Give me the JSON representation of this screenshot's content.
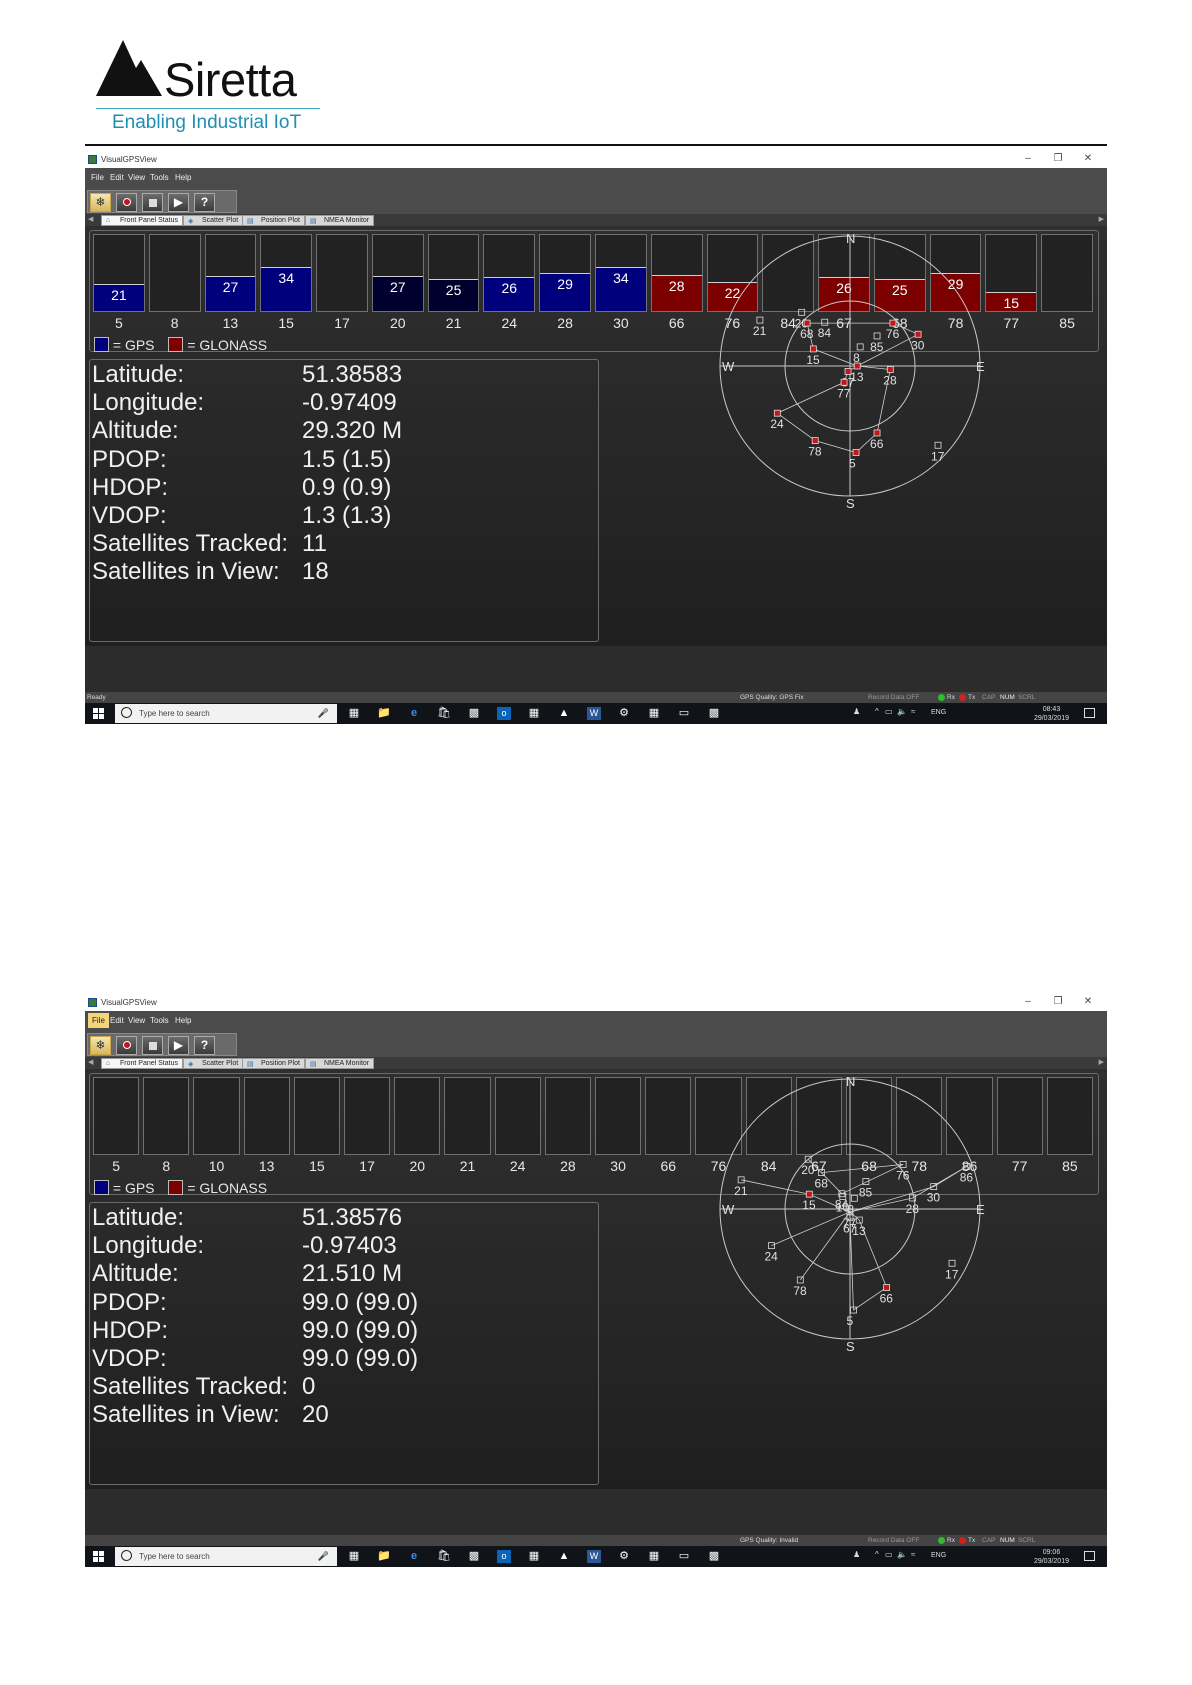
{
  "brand": {
    "name": "Siretta",
    "tagline": "Enabling Industrial IoT"
  },
  "colors": {
    "gps_bar": "#00007c",
    "gps_bar_weak": "#00002e",
    "glonass_bar": "#7c0000",
    "panel_bg": "#2c2c2c",
    "accent_menu": "#f6d47a"
  },
  "app": {
    "window_title": "VisualGPSView",
    "menu": [
      "File",
      "Edit",
      "View",
      "Tools",
      "Help"
    ],
    "toolbar_icons": [
      "gps-settings-icon",
      "record-icon",
      "stop-icon",
      "play-icon",
      "help-icon"
    ],
    "toolbar_help_glyph": "?",
    "tabs": [
      "Front Panel Status",
      "Scatter Plot",
      "Position Plot",
      "NMEA Monitor"
    ],
    "legend": {
      "gps": "= GPS",
      "glonass": "= GLONASS"
    },
    "info_labels": [
      "Latitude:",
      "Longitude:",
      "Altitude:",
      "PDOP:",
      "HDOP:",
      "VDOP:",
      "Satellites Tracked:",
      "Satellites in View:"
    ],
    "compass": {
      "n": "N",
      "s": "S",
      "e": "E",
      "w": "W"
    },
    "status_record": "Record Data OFF",
    "status_rx": "Rx",
    "status_tx": "Tx",
    "status_keys": [
      "CAP",
      "NUM",
      "SCRL"
    ],
    "task_search_placeholder": "Type here to search",
    "tray_lang": "ENG"
  },
  "screens": [
    {
      "menu_active": -1,
      "status_ready": "Ready",
      "gps_quality": "GPS Quality: GPS Fix",
      "clock_time": "08:43",
      "clock_date": "29/03/2019",
      "bars": [
        {
          "prn": "5",
          "snr": 21,
          "sys": "gps"
        },
        {
          "prn": "8",
          "snr": null,
          "sys": "none"
        },
        {
          "prn": "13",
          "snr": 27,
          "sys": "gps"
        },
        {
          "prn": "15",
          "snr": 34,
          "sys": "gps"
        },
        {
          "prn": "17",
          "snr": null,
          "sys": "none"
        },
        {
          "prn": "20",
          "snr": 27,
          "sys": "gps_weak"
        },
        {
          "prn": "21",
          "snr": 25,
          "sys": "gps_weak"
        },
        {
          "prn": "24",
          "snr": 26,
          "sys": "gps"
        },
        {
          "prn": "28",
          "snr": 29,
          "sys": "gps"
        },
        {
          "prn": "30",
          "snr": 34,
          "sys": "gps"
        },
        {
          "prn": "66",
          "snr": 28,
          "sys": "glonass"
        },
        {
          "prn": "76",
          "snr": 22,
          "sys": "glonass"
        },
        {
          "prn": "84",
          "snr": null,
          "sys": "none"
        },
        {
          "prn": "67",
          "snr": 26,
          "sys": "glonass"
        },
        {
          "prn": "68",
          "snr": 25,
          "sys": "glonass"
        },
        {
          "prn": "78",
          "snr": 29,
          "sys": "glonass"
        },
        {
          "prn": "77",
          "snr": 15,
          "sys": "glonass"
        },
        {
          "prn": "85",
          "snr": null,
          "sys": "none"
        }
      ],
      "info_values": [
        "51.38583",
        "-0.97409",
        "29.320 M",
        "1.5 (1.5)",
        "0.9 (0.9)",
        "1.3 (1.3)",
        "11",
        "18"
      ],
      "sky": [
        {
          "prn": "84",
          "az": 330,
          "el": 55,
          "used": false
        },
        {
          "prn": "8",
          "az": 28,
          "el": 75,
          "used": false
        },
        {
          "prn": "85",
          "az": 42,
          "el": 62,
          "used": false
        },
        {
          "prn": "20",
          "az": 318,
          "el": 40,
          "used": false
        },
        {
          "prn": "68",
          "az": 315,
          "el": 48,
          "used": true
        },
        {
          "prn": "76",
          "az": 45,
          "el": 48,
          "used": true
        },
        {
          "prn": "21",
          "az": 297,
          "el": 20,
          "used": false
        },
        {
          "prn": "30",
          "az": 65,
          "el": 38,
          "used": true
        },
        {
          "prn": "15",
          "az": 295,
          "el": 62,
          "used": true
        },
        {
          "prn": "13",
          "az": 90,
          "el": 85,
          "used": true
        },
        {
          "prn": "28",
          "az": 95,
          "el": 62,
          "used": true
        },
        {
          "prn": "67",
          "az": 200,
          "el": 86,
          "used": true
        },
        {
          "prn": "77",
          "az": 200,
          "el": 78,
          "used": true
        },
        {
          "prn": "24",
          "az": 237,
          "el": 30,
          "used": true
        },
        {
          "prn": "78",
          "az": 205,
          "el": 33,
          "used": true
        },
        {
          "prn": "5",
          "az": 176,
          "el": 30,
          "used": true
        },
        {
          "prn": "66",
          "az": 158,
          "el": 40,
          "used": true
        },
        {
          "prn": "17",
          "az": 132,
          "el": 8,
          "used": false
        }
      ],
      "tracks": [
        [
          "68",
          "76",
          "30",
          "13",
          "15",
          "68"
        ],
        [
          "28",
          "13",
          "67",
          "77",
          "24",
          "78",
          "5",
          "66",
          "28"
        ]
      ]
    },
    {
      "menu_active": 0,
      "status_ready": "",
      "gps_quality": "GPS Quality: Invalid",
      "clock_time": "09:06",
      "clock_date": "29/03/2019",
      "bars": [
        {
          "prn": "5",
          "snr": null,
          "sys": "none"
        },
        {
          "prn": "8",
          "snr": null,
          "sys": "none"
        },
        {
          "prn": "10",
          "snr": null,
          "sys": "none"
        },
        {
          "prn": "13",
          "snr": null,
          "sys": "none"
        },
        {
          "prn": "15",
          "snr": null,
          "sys": "none"
        },
        {
          "prn": "17",
          "snr": null,
          "sys": "none"
        },
        {
          "prn": "20",
          "snr": null,
          "sys": "none"
        },
        {
          "prn": "21",
          "snr": null,
          "sys": "none"
        },
        {
          "prn": "24",
          "snr": null,
          "sys": "none"
        },
        {
          "prn": "28",
          "snr": null,
          "sys": "none"
        },
        {
          "prn": "30",
          "snr": null,
          "sys": "none"
        },
        {
          "prn": "66",
          "snr": null,
          "sys": "none"
        },
        {
          "prn": "76",
          "snr": null,
          "sys": "none"
        },
        {
          "prn": "84",
          "snr": null,
          "sys": "none"
        },
        {
          "prn": "67",
          "snr": null,
          "sys": "none"
        },
        {
          "prn": "68",
          "snr": null,
          "sys": "none"
        },
        {
          "prn": "78",
          "snr": null,
          "sys": "none"
        },
        {
          "prn": "86",
          "snr": null,
          "sys": "none"
        },
        {
          "prn": "77",
          "snr": null,
          "sys": "none"
        },
        {
          "prn": "85",
          "snr": null,
          "sys": "none"
        }
      ],
      "info_values": [
        "51.38576",
        "-0.97403",
        "21.510 M",
        "99.0 (99.0)",
        "99.0 (99.0)",
        "99.0 (99.0)",
        "0",
        "20"
      ],
      "sky": [
        {
          "prn": "10",
          "az": 330,
          "el": 80,
          "used": false
        },
        {
          "prn": "84",
          "az": 332,
          "el": 78,
          "used": false
        },
        {
          "prn": "8",
          "az": 22,
          "el": 82,
          "used": false
        },
        {
          "prn": "85",
          "az": 30,
          "el": 68,
          "used": false
        },
        {
          "prn": "20",
          "az": 320,
          "el": 45,
          "used": false
        },
        {
          "prn": "68",
          "az": 322,
          "el": 58,
          "used": false
        },
        {
          "prn": "76",
          "az": 50,
          "el": 42,
          "used": false
        },
        {
          "prn": "86",
          "az": 70,
          "el": 4,
          "used": false
        },
        {
          "prn": "30",
          "az": 75,
          "el": 30,
          "used": false
        },
        {
          "prn": "28",
          "az": 80,
          "el": 46,
          "used": false
        },
        {
          "prn": "21",
          "az": 285,
          "el": 12,
          "used": false
        },
        {
          "prn": "15",
          "az": 290,
          "el": 60,
          "used": true
        },
        {
          "prn": "77",
          "az": 180,
          "el": 88,
          "used": false
        },
        {
          "prn": "13",
          "az": 140,
          "el": 80,
          "used": false
        },
        {
          "prn": "67",
          "az": 180,
          "el": 84,
          "used": false
        },
        {
          "prn": "24",
          "az": 245,
          "el": 30,
          "used": false
        },
        {
          "prn": "78",
          "az": 215,
          "el": 30,
          "used": false
        },
        {
          "prn": "17",
          "az": 118,
          "el": 10,
          "used": false
        },
        {
          "prn": "5",
          "az": 178,
          "el": 20,
          "used": false
        },
        {
          "prn": "66",
          "az": 155,
          "el": 30,
          "used": true
        }
      ],
      "tracks": [
        [
          "84",
          "76",
          "68",
          "20",
          "84"
        ],
        [
          "21",
          "15",
          "77",
          "30",
          "86",
          "28",
          "77"
        ],
        [
          "24",
          "77",
          "78"
        ],
        [
          "77",
          "67",
          "5",
          "66",
          "13",
          "77"
        ]
      ]
    }
  ]
}
